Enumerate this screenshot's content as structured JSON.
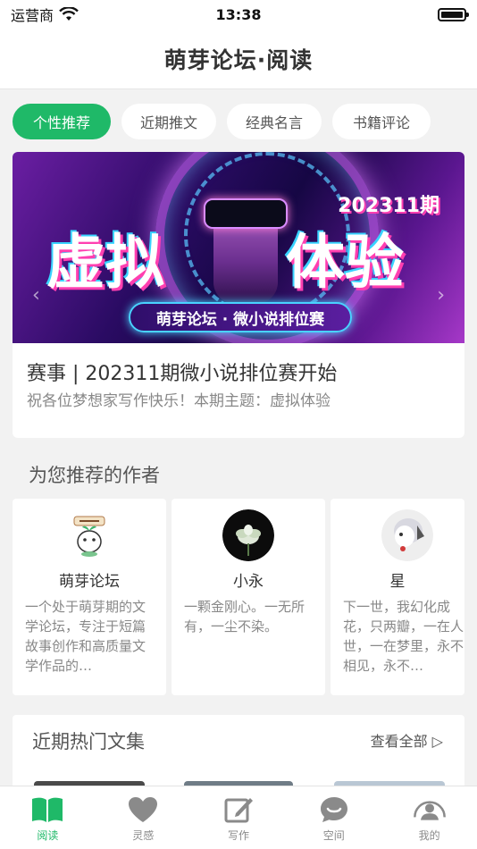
{
  "status_bar": {
    "carrier": "运营商",
    "time": "13:38"
  },
  "nav": {
    "title": "萌芽论坛·阅读"
  },
  "tabs": [
    {
      "label": "个性推荐",
      "active": true
    },
    {
      "label": "近期推文",
      "active": false
    },
    {
      "label": "经典名言",
      "active": false
    },
    {
      "label": "书籍评论",
      "active": false
    }
  ],
  "banner": {
    "headline_left": "虚拟",
    "headline_right": "体验",
    "period_badge": "202311期",
    "pill_text": "萌芽论坛 · 微小说排位赛",
    "title": "赛事 | 202311期微小说排位赛开始",
    "subtitle": "祝各位梦想家写作快乐！本期主题：虚拟体验"
  },
  "authors_section": {
    "title": "为您推荐的作者",
    "authors": [
      {
        "name": "萌芽论坛",
        "bio": "一个处于萌芽期的文学论坛，专注于短篇故事创作和高质量文学作品的…"
      },
      {
        "name": "小永",
        "bio": "一颗金刚心。一无所有，一尘不染。"
      },
      {
        "name": "星",
        "bio": "下一世，我幻化成花，只两瓣，一在人世，一在梦里，永不相见，永不…"
      }
    ]
  },
  "collections": {
    "title": "近期热门文集",
    "see_all": "查看全部 ▷"
  },
  "tab_bar": [
    {
      "label": "阅读",
      "icon": "book-icon",
      "active": true
    },
    {
      "label": "灵感",
      "icon": "heart-icon",
      "active": false
    },
    {
      "label": "写作",
      "icon": "edit-icon",
      "active": false
    },
    {
      "label": "空间",
      "icon": "chat-bubble-icon",
      "active": false
    },
    {
      "label": "我的",
      "icon": "profile-icon",
      "active": false
    }
  ],
  "colors": {
    "accent": "#1fb968",
    "inactive": "#8a8a8a"
  }
}
